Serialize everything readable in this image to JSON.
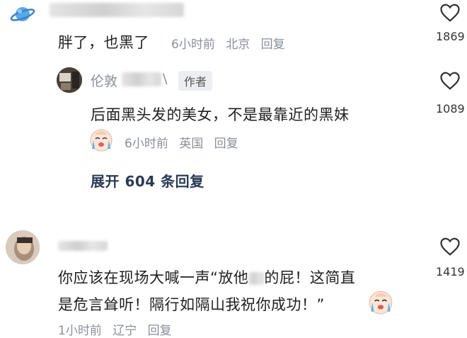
{
  "comments": [
    {
      "text": "胖了，也黑了",
      "time": "6小时前",
      "location": "北京",
      "reply": "回复",
      "likes": "1869"
    },
    {
      "tag": "作者",
      "name_visible": "伦敦",
      "name_end": "\\",
      "text": "后面黑头发的美女，不是最靠近的黑妹",
      "time": "6小时前",
      "location": "英国",
      "reply": "回复",
      "likes": "1089"
    },
    {
      "text_line1": "你应该在现场大喊一声“放他",
      "text_line1_end": "的屁！这简直",
      "text_line2": "是危言耸听！隔行如隔山我祝你成功！”",
      "time": "1小时前",
      "location": "辽宁",
      "reply": "回复",
      "likes": "1419"
    }
  ],
  "expand_replies": "展开 604 条回复",
  "colors": {
    "text": "#1f1f1f",
    "meta": "#8a8f99",
    "expand": "#2a3a55",
    "tag_bg": "#eceef1"
  }
}
